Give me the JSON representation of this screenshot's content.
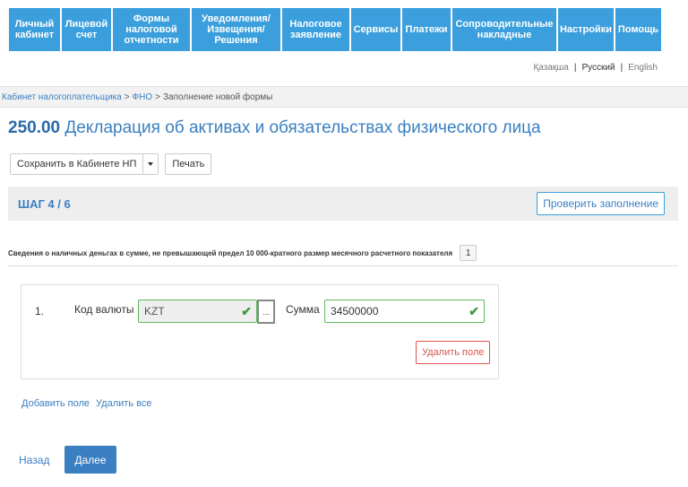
{
  "nav": [
    {
      "label": "Личный кабинет"
    },
    {
      "label": "Лицевой счет"
    },
    {
      "label": "Формы налоговой отчетности"
    },
    {
      "label": "Уведомления/ Извещения/ Решения"
    },
    {
      "label": "Налоговое заявление"
    },
    {
      "label": "Сервисы"
    },
    {
      "label": "Платежи"
    },
    {
      "label": "Сопроводительные накладные"
    },
    {
      "label": "Настройки"
    },
    {
      "label": "Помощь"
    }
  ],
  "languages": {
    "kazakh": "Қазақша",
    "sep1": "|",
    "russian": "Русский",
    "sep2": "|",
    "english": "English"
  },
  "breadcrumb": {
    "item1": "Кабинет налогоплательщика",
    "item2": "ФНО",
    "current": "Заполнение новой формы",
    "sep": ">"
  },
  "title": {
    "code": "250.00",
    "text": "Декларация об активах и обязательствах физического лица"
  },
  "toolbar": {
    "save_label": "Сохранить в Кабинете НП",
    "print_label": "Печать"
  },
  "step": {
    "label": "ШАГ 4 / 6",
    "check_label": "Проверить заполнение"
  },
  "section": {
    "title": "Сведения о наличных деньгах в сумме, не превышающей предел 10 000-кратного размер месячного расчетного показателя",
    "count": "1"
  },
  "item": {
    "number": "1.",
    "currency_label": "Код валюты",
    "currency_value": "KZT",
    "dots_label": "...",
    "sum_label": "Сумма",
    "sum_value": "34500000",
    "remove_label": "Удалить поле",
    "check_icon": "✔"
  },
  "links": {
    "add": "Добавить поле",
    "remove_all": "Удалить все"
  },
  "footer": {
    "back": "Назад",
    "next": "Далее"
  }
}
